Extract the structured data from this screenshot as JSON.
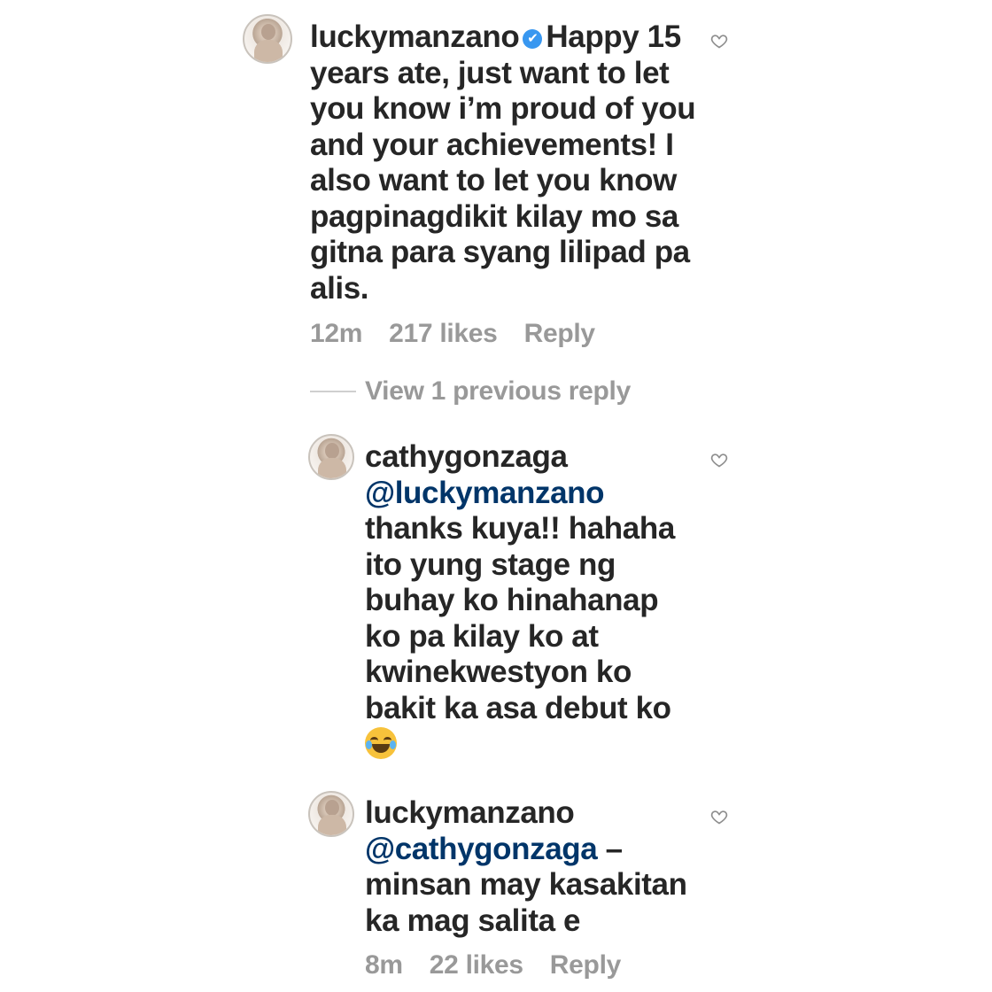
{
  "comments": [
    {
      "username": "luckymanzano",
      "verified": true,
      "verified_icon": "✔",
      "text": "Happy 15 years ate, just want to let you know i’m proud of you and your achievements! I also want to let you know pagpinagdikit kilay mo sa gitna para syang lilipad pa alis.",
      "lines": [
        "years ate, just want to let",
        "you know i’m proud of you",
        "and your achievements! I",
        "also want to let you know",
        "pagpinagdikit kilay mo sa",
        "gitna para syang lilipad pa",
        "alis."
      ],
      "first_line_text": "Happy 15",
      "time": "12m",
      "likes": "217 likes",
      "reply_label": "Reply"
    }
  ],
  "view_replies_label": "View 1 previous reply",
  "replies": [
    {
      "username": "cathygonzaga",
      "mention": "@luckymanzano",
      "lines": [
        "thanks kuya!! hahaha",
        "ito yung stage ng",
        "buhay ko hinahanap",
        "ko pa kilay ko at",
        "kwinekwestyon ko",
        "bakit ka asa debut ko"
      ],
      "emoji": "face-with-tears-of-joy"
    },
    {
      "username": "luckymanzano",
      "mention": "@cathygonzaga",
      "mention_suffix": " –",
      "lines": [
        "minsan may kasakitan",
        "ka mag salita e"
      ],
      "time": "8m",
      "likes": "22 likes",
      "reply_label": "Reply"
    }
  ],
  "icons": {
    "like": "heart-outline-icon",
    "verified": "verified-badge-icon"
  },
  "colors": {
    "text": "#262626",
    "meta": "#999999",
    "mention": "#003569",
    "verified": "#3897f0"
  }
}
